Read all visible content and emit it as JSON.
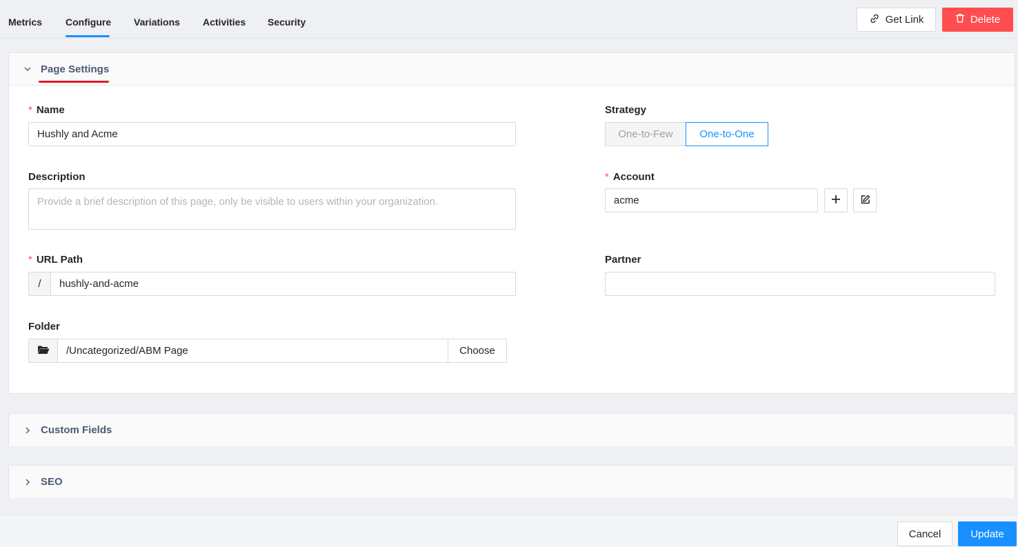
{
  "tabs": [
    {
      "label": "Metrics"
    },
    {
      "label": "Configure"
    },
    {
      "label": "Variations"
    },
    {
      "label": "Activities"
    },
    {
      "label": "Security"
    }
  ],
  "active_tab": "Configure",
  "actions": {
    "get_link_label": "Get Link",
    "delete_label": "Delete"
  },
  "page_settings": {
    "title": "Page Settings",
    "name": {
      "label": "Name",
      "required_mark": "*",
      "value": "Hushly and Acme"
    },
    "description": {
      "label": "Description",
      "placeholder": "Provide a brief description of this page, only be visible to users within your organization."
    },
    "url_path": {
      "label": "URL Path",
      "required_mark": "*",
      "prefix": "/",
      "value": "hushly-and-acme"
    },
    "folder": {
      "label": "Folder",
      "value": "/Uncategorized/ABM Page",
      "choose_label": "Choose"
    },
    "strategy": {
      "label": "Strategy",
      "options": [
        "One-to-Few",
        "One-to-One"
      ],
      "selected": "One-to-One"
    },
    "account": {
      "label": "Account",
      "required_mark": "*",
      "value": "acme"
    },
    "partner": {
      "label": "Partner",
      "value": ""
    }
  },
  "custom_fields": {
    "title": "Custom Fields"
  },
  "seo": {
    "title": "SEO"
  },
  "footer": {
    "cancel_label": "Cancel",
    "update_label": "Update"
  },
  "colors": {
    "primary": "#1890ff",
    "danger": "#ff4d4f",
    "highlight": "#e0192a",
    "header_text": "#4a5a75"
  },
  "icons": {
    "get_link": "link-icon",
    "delete": "trash-icon",
    "collapse": "chevron-down-icon",
    "expand": "chevron-right-icon",
    "folder": "folder-open-icon",
    "add": "plus-icon",
    "edit": "edit-icon"
  }
}
